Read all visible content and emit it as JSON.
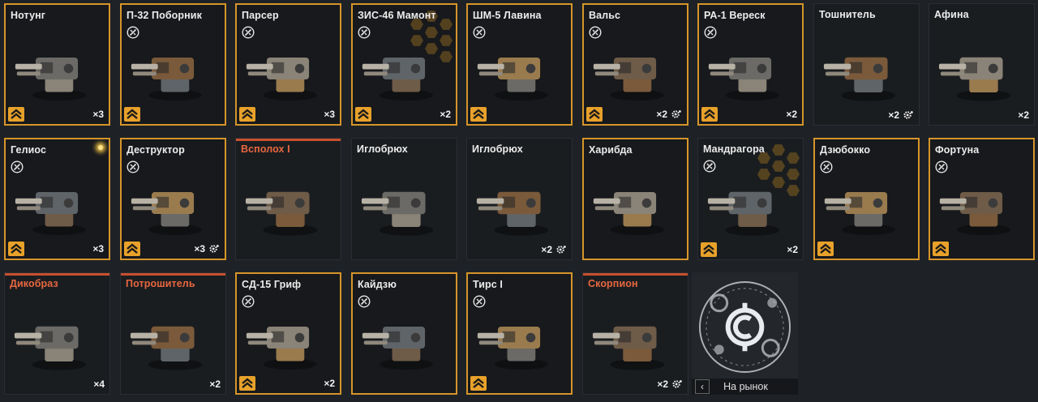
{
  "cards": [
    {
      "name": "Нотунг",
      "rarity": "orange",
      "mod": false,
      "count": "×3",
      "gear": false,
      "hex": false,
      "glow": false
    },
    {
      "name": "П-32 Поборник",
      "rarity": "orange",
      "mod": true,
      "count": "",
      "gear": false,
      "hex": false,
      "glow": false
    },
    {
      "name": "Парсер",
      "rarity": "orange",
      "mod": true,
      "count": "×3",
      "gear": false,
      "hex": false,
      "glow": false
    },
    {
      "name": "ЗИС-46 Мамонт",
      "rarity": "orange",
      "mod": true,
      "count": "×2",
      "gear": false,
      "hex": true,
      "glow": false
    },
    {
      "name": "ШМ-5 Лавина",
      "rarity": "orange",
      "mod": true,
      "count": "",
      "gear": false,
      "hex": false,
      "glow": false
    },
    {
      "name": "Вальс",
      "rarity": "orange",
      "mod": true,
      "count": "×2",
      "gear": true,
      "hex": false,
      "glow": false
    },
    {
      "name": "РА-1 Вереск",
      "rarity": "orange",
      "mod": true,
      "count": "×2",
      "gear": false,
      "hex": false,
      "glow": false
    },
    {
      "name": "Тошнитель",
      "rarity": "dark",
      "mod": false,
      "count": "×2",
      "gear": true,
      "hex": false,
      "glow": false
    },
    {
      "name": "Афина",
      "rarity": "dark",
      "mod": false,
      "count": "×2",
      "gear": false,
      "hex": false,
      "glow": false
    },
    {
      "name": "Гелиос",
      "rarity": "orange",
      "mod": true,
      "count": "×3",
      "gear": false,
      "hex": false,
      "glow": true
    },
    {
      "name": "Деструктор",
      "rarity": "orange",
      "mod": true,
      "count": "×3",
      "gear": true,
      "hex": false,
      "glow": false
    },
    {
      "name": "Всполох I",
      "rarity": "red",
      "mod": false,
      "count": "",
      "gear": false,
      "hex": false,
      "glow": false
    },
    {
      "name": "Иглобрюх",
      "rarity": "dark",
      "mod": false,
      "count": "",
      "gear": false,
      "hex": false,
      "glow": false
    },
    {
      "name": "Иглобрюх",
      "rarity": "dark",
      "mod": false,
      "count": "×2",
      "gear": true,
      "hex": false,
      "glow": false
    },
    {
      "name": "Харибда",
      "rarity": "orange",
      "mod": false,
      "count": "",
      "gear": false,
      "hex": false,
      "glow": false
    },
    {
      "name": "Мандрагора",
      "rarity": "dark",
      "mod": true,
      "count": "×2",
      "gear": false,
      "hex": true,
      "glow": false
    },
    {
      "name": "Дзюбокко",
      "rarity": "orange",
      "mod": true,
      "count": "",
      "gear": false,
      "hex": false,
      "glow": false
    },
    {
      "name": "Фортуна",
      "rarity": "orange",
      "mod": true,
      "count": "",
      "gear": false,
      "hex": false,
      "glow": false
    },
    {
      "name": "Дикобраз",
      "rarity": "red",
      "mod": false,
      "count": "×4",
      "gear": false,
      "hex": false,
      "glow": false
    },
    {
      "name": "Потрошитель",
      "rarity": "red",
      "mod": false,
      "count": "×2",
      "gear": false,
      "hex": false,
      "glow": false
    },
    {
      "name": "СД-15 Гриф",
      "rarity": "orange",
      "mod": true,
      "count": "×2",
      "gear": false,
      "hex": false,
      "glow": false
    },
    {
      "name": "Кайдзю",
      "rarity": "orange",
      "mod": true,
      "count": "",
      "gear": false,
      "hex": false,
      "glow": false
    },
    {
      "name": "Тирс I",
      "rarity": "orange",
      "mod": true,
      "count": "",
      "gear": false,
      "hex": false,
      "glow": false
    },
    {
      "name": "Скорпион",
      "rarity": "red",
      "mod": false,
      "count": "×2",
      "gear": true,
      "hex": false,
      "glow": false
    }
  ],
  "rank_badges": [
    0,
    1,
    2,
    3,
    4,
    5,
    6,
    9,
    10,
    15,
    16,
    17,
    20,
    22
  ],
  "market": {
    "label": "На рынок",
    "back_icon": "chevron-left-icon"
  },
  "colors": {
    "orange": "#d6952a",
    "red_title": "#e8673f",
    "background": "#1e2226"
  }
}
